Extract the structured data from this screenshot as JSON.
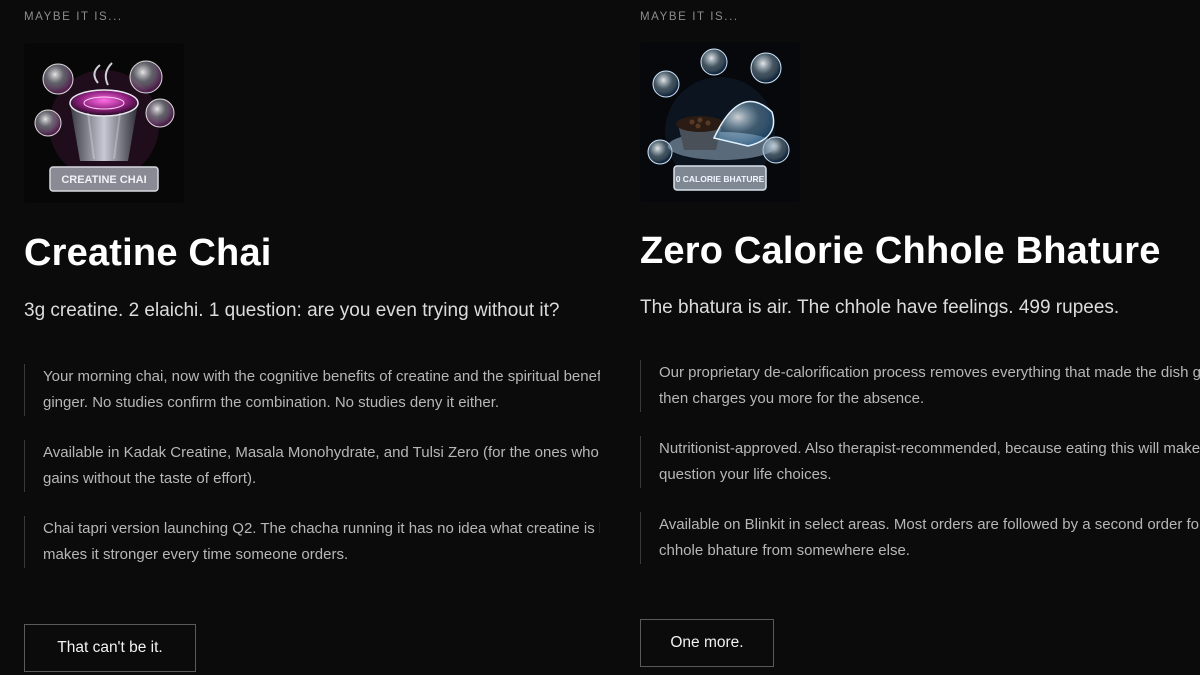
{
  "cards": [
    {
      "eyebrow": "MAYBE IT IS...",
      "image_label": "CREATINE CHAI",
      "title": "Creatine Chai",
      "tagline": "3g creatine. 2 elaichi. 1 question: are you even trying without it?",
      "bullets": [
        [
          "Your morning chai, now with the cognitive benefits of creatine and the spiritual benefits of",
          "ginger. No studies confirm the combination. No studies deny it either."
        ],
        [
          "Available in Kadak Creatine, Masala Monohydrate, and Tulsi Zero (for the ones who want",
          "gains without the taste of effort)."
        ],
        [
          "Chai tapri version launching Q2. The chacha running it has no idea what creatine is but",
          "makes it stronger every time someone orders."
        ]
      ],
      "button": "That can't be it."
    },
    {
      "eyebrow": "MAYBE IT IS...",
      "image_label": "0 CALORIE BHATURE",
      "title": "Zero Calorie Chhole Bhature",
      "tagline": "The bhatura is air. The chhole have feelings. 499 rupees.",
      "bullets": [
        [
          "Our proprietary de-calorification process removes everything that made the dish good",
          "then charges you more for the absence."
        ],
        [
          "Nutritionist-approved. Also therapist-recommended, because eating this will make you",
          "question your life choices."
        ],
        [
          "Available on Blinkit in select areas. Most orders are followed by a second order for real",
          "chhole bhature from somewhere else."
        ]
      ],
      "button": "One more."
    }
  ],
  "colors": {
    "background": "#0b0b0b",
    "title": "#ffffff",
    "body_text": "#b7b7b7",
    "eyebrow": "#8c8c8c",
    "accent_pink": "#e040c0",
    "accent_cyan": "#7fd4ff"
  }
}
